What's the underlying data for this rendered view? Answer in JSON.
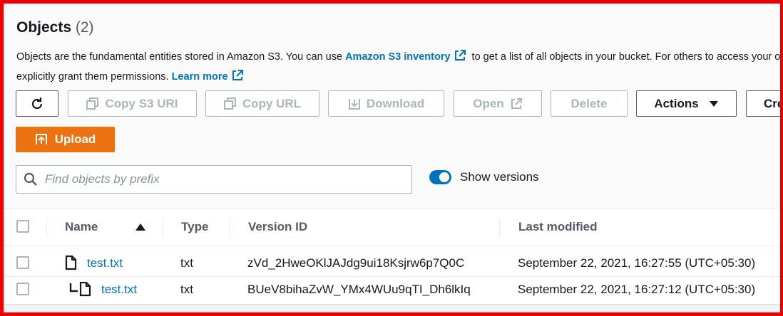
{
  "header": {
    "title": "Objects",
    "count": "(2)"
  },
  "description": {
    "text1": "Objects are the fundamental entities stored in Amazon S3. You can use ",
    "inventory_link": "Amazon S3 inventory",
    "text2": " to get a list of all objects in your bucket. For others to access your objects, you'll need to",
    "text3": "explicitly grant them permissions. ",
    "learn_more": "Learn more"
  },
  "toolbar": {
    "refresh_icon": "refresh-icon",
    "copy_s3_uri": "Copy S3 URI",
    "copy_url": "Copy URL",
    "download": "Download",
    "open": "Open",
    "delete": "Delete",
    "actions": "Actions",
    "create_folder": "Cre",
    "upload": "Upload"
  },
  "search": {
    "placeholder": "Find objects by prefix",
    "value": ""
  },
  "versions_toggle": {
    "label": "Show versions",
    "enabled": true
  },
  "table": {
    "columns": [
      "Name",
      "Type",
      "Version ID",
      "Last modified"
    ],
    "sort": "ascending",
    "rows": [
      {
        "name": "test.txt",
        "type": "txt",
        "version_id": "zVd_2HweOKlJAJdg9ui18Ksjrw6p7Q0C",
        "last_modified": "September 22, 2021, 16:27:55 (UTC+05:30)"
      },
      {
        "name": "test.txt",
        "type": "txt",
        "version_id": "BUeV8bihaZvW_YMx4WUu9qTI_Dh6lkIq",
        "last_modified": "September 22, 2021, 16:27:12 (UTC+05:30)"
      }
    ]
  },
  "colors": {
    "accent_link": "#0073bb",
    "upload_orange": "#ec7211",
    "frame_red": "#ee0000"
  }
}
